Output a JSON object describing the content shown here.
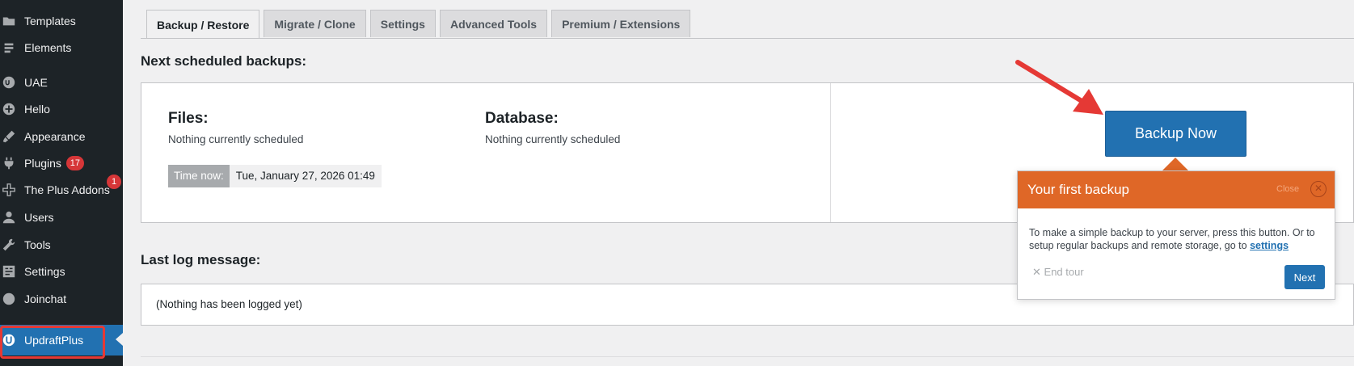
{
  "sidebar": {
    "items": [
      {
        "label": "Templates",
        "icon": "folder-icon"
      },
      {
        "label": "Elements",
        "icon": "elements-icon"
      },
      {
        "label": "UAE",
        "icon": "uae-icon"
      },
      {
        "label": "Hello",
        "icon": "plus-circle-icon"
      },
      {
        "label": "Appearance",
        "icon": "paintbrush-icon"
      },
      {
        "label": "Plugins",
        "icon": "plug-icon",
        "badge": "17"
      },
      {
        "label": "The Plus Addons",
        "icon": "plus-addons-icon",
        "badge": "1"
      },
      {
        "label": "Users",
        "icon": "user-icon"
      },
      {
        "label": "Tools",
        "icon": "wrench-icon"
      },
      {
        "label": "Settings",
        "icon": "settings-icon"
      },
      {
        "label": "Joinchat",
        "icon": "chat-bubble-icon"
      },
      {
        "label": "UpdraftPlus",
        "icon": "updraftplus-icon",
        "active": true
      }
    ]
  },
  "tabs": [
    "Backup / Restore",
    "Migrate / Clone",
    "Settings",
    "Advanced Tools",
    "Premium / Extensions"
  ],
  "scheduled": {
    "heading": "Next scheduled backups:",
    "files_title": "Files:",
    "files_text": "Nothing currently scheduled",
    "database_title": "Database:",
    "database_text": "Nothing currently scheduled",
    "time_label": "Time now:",
    "time_value": "Tue, January 27, 2026 01:49",
    "backup_button": "Backup Now"
  },
  "log": {
    "heading": "Last log message:",
    "message": "(Nothing has been logged yet)"
  },
  "tour": {
    "title": "Your first backup",
    "close_label": "Close",
    "body_text": "To make a simple backup to your server, press this button. Or to setup regular backups and remote storage, go to",
    "link_text": "settings",
    "end_tour": "End tour",
    "next": "Next"
  },
  "colors": {
    "sidebar_bg": "#1d2327",
    "accent_blue": "#2271b1",
    "tour_orange": "#df6727",
    "badge_red": "#d63638",
    "annotation_red": "#e53935"
  }
}
